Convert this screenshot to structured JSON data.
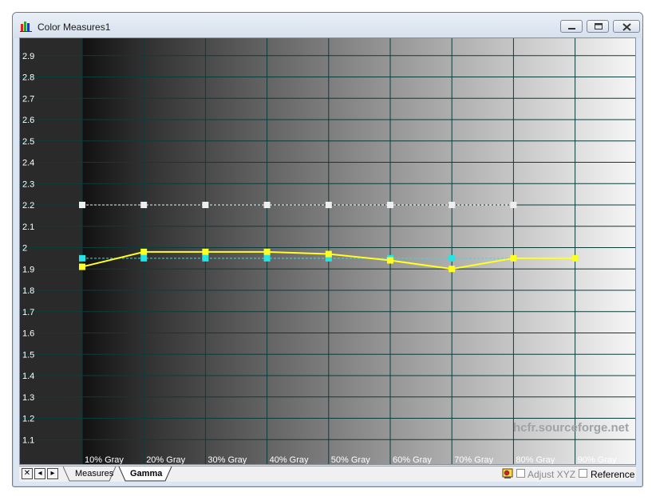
{
  "window": {
    "title": "Color Measures1"
  },
  "tabs": [
    {
      "label": "Measures",
      "active": false
    },
    {
      "label": "Gamma",
      "active": true
    }
  ],
  "toolbar": {
    "adjust_xyz_label": "Adjust XYZ",
    "reference_label": "Reference",
    "adjust_xyz_enabled": false,
    "adjust_xyz_checked": false,
    "reference_checked": false
  },
  "chart_data": {
    "type": "line",
    "categories": [
      "10% Gray",
      "20% Gray",
      "30% Gray",
      "40% Gray",
      "50% Gray",
      "60% Gray",
      "70% Gray",
      "80% Gray",
      "90% Gray"
    ],
    "ylim": [
      1.0,
      3.0
    ],
    "yticks": [
      1.1,
      1.2,
      1.3,
      1.4,
      1.5,
      1.6,
      1.7,
      1.8,
      1.9,
      2,
      2.1,
      2.2,
      2.3,
      2.4,
      2.5,
      2.6,
      2.7,
      2.8,
      2.9
    ],
    "grid": true,
    "watermark": "hcfr.sourceforge.net",
    "series": [
      {
        "key": "reference",
        "color": "#eeeeee",
        "dashed": true,
        "values": [
          2.2,
          2.2,
          2.2,
          2.2,
          2.2,
          2.2,
          2.2,
          2.2,
          null
        ]
      },
      {
        "key": "average",
        "color": "#22e6e6",
        "dashed": true,
        "values": [
          1.95,
          1.95,
          1.95,
          1.95,
          1.95,
          1.95,
          1.95,
          1.95,
          1.95
        ]
      },
      {
        "key": "measured",
        "color": "#ffff22",
        "dashed": false,
        "values": [
          1.91,
          1.98,
          1.98,
          1.98,
          1.97,
          1.94,
          1.9,
          1.95,
          1.95
        ]
      }
    ],
    "background_color": "#2a2a2a",
    "grid_color": "#0b3c3c",
    "tick_color": "#ffffff"
  }
}
